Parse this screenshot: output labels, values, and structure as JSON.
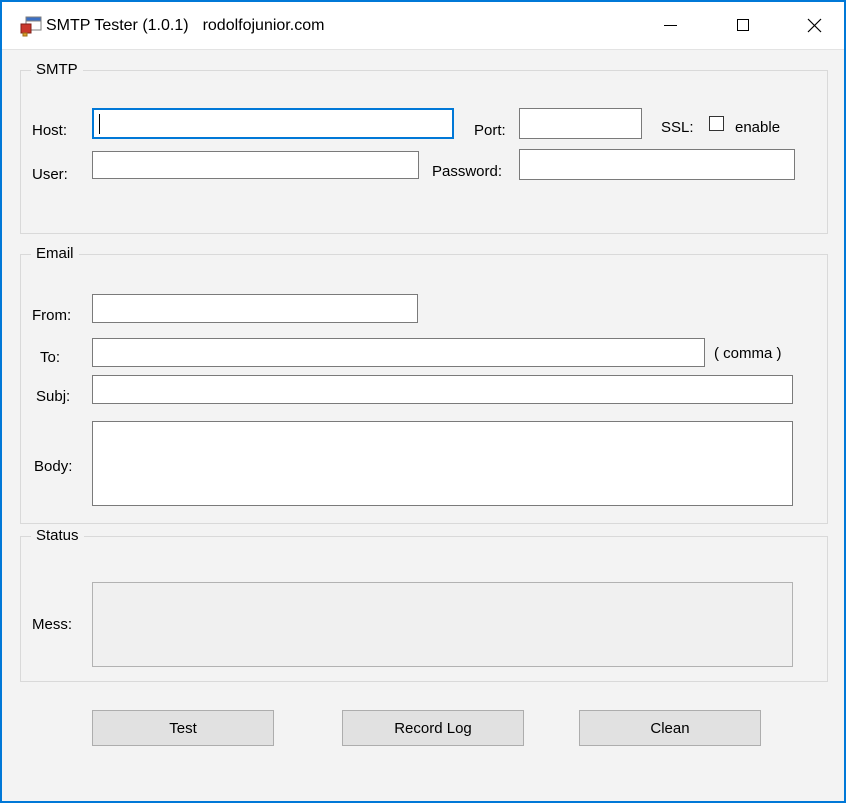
{
  "window": {
    "title": "SMTP Tester (1.0.1)",
    "subtitle": "rodolfojunior.com"
  },
  "smtp": {
    "legend": "SMTP",
    "host_label": "Host:",
    "host_value": "",
    "port_label": "Port:",
    "port_value": "",
    "ssl_label": "SSL:",
    "ssl_enable_label": "enable",
    "ssl_checked": false,
    "user_label": "User:",
    "user_value": "",
    "password_label": "Password:",
    "password_value": ""
  },
  "email": {
    "legend": "Email",
    "from_label": "From:",
    "from_value": "",
    "to_label": "To:",
    "to_value": "",
    "to_hint": "( comma )",
    "subj_label": "Subj:",
    "subj_value": "",
    "body_label": "Body:",
    "body_value": ""
  },
  "status": {
    "legend": "Status",
    "mess_label": "Mess:",
    "mess_value": ""
  },
  "buttons": {
    "test": "Test",
    "record_log": "Record Log",
    "clean": "Clean"
  },
  "colors": {
    "accent_border": "#0078d7",
    "focus_border": "#0078d7",
    "button_face": "#e1e1e1",
    "readonly_face": "#f0f0f0"
  }
}
